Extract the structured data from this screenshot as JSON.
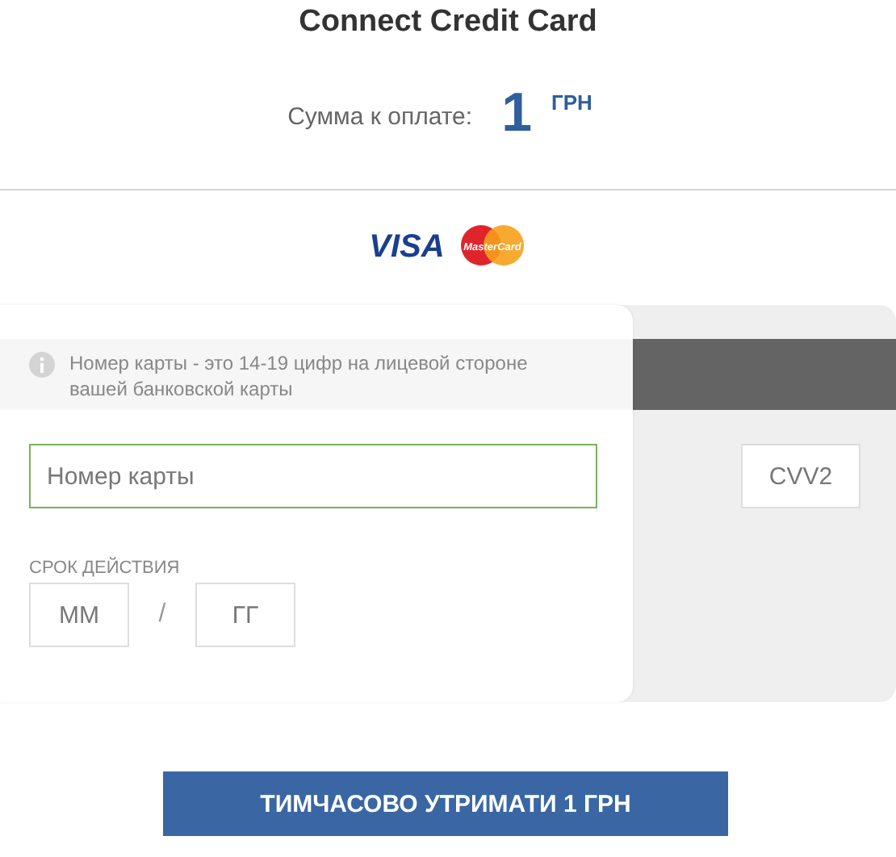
{
  "title": "Connect Credit Card",
  "amount": {
    "label": "Сумма к оплате:",
    "value": "1",
    "currency": "ГРН"
  },
  "logos": [
    {
      "kind": "visa",
      "text": "VISA"
    },
    {
      "kind": "mastercard",
      "text": "MasterCard"
    }
  ],
  "card_form": {
    "hint": "Номер карты - это 14-19 цифр на лицевой стороне вашей банковской карты",
    "card_number": {
      "placeholder": "Номер карты",
      "focused": true
    },
    "expiry_label": "СРОК ДЕЙСТВИЯ",
    "month": {
      "placeholder": "ММ"
    },
    "separator": "/",
    "year": {
      "placeholder": "ГГ"
    },
    "cvv": {
      "placeholder": "CVV2"
    }
  },
  "submit_button": "ТИМЧАСОВО УТРИМАТИ 1 ГРН"
}
